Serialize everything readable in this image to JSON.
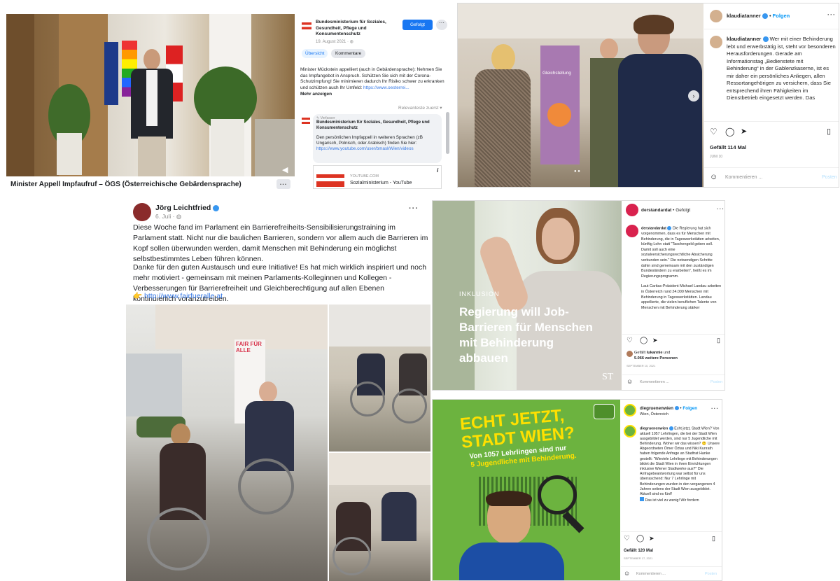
{
  "video_post": {
    "caption": "Minister Appell Impfaufruf – ÖGS (Österreichische Gebärdensprache)",
    "more": "..."
  },
  "fb_ministry": {
    "page_name": "Bundesministerium für Soziales, Gesundheit, Pflege und Konsumentenschutz",
    "date": "19. August 2021 · ",
    "follow_label": "Gefolgt",
    "tab_overview": "Übersicht",
    "tab_comments": "Kommentare",
    "body": "Minister Mückstein appelliert (auch in Gebärdensprache): Nehmen Sie das Impfangebot in Anspruch. Schützen Sie sich mit der Corona-Schutzimpfung! Sie minimieren dadurch Ihr Risiko schwer zu erkranken und schützen auch Ihr Umfeld: ",
    "body_link": "https://www.oesterrei...",
    "more": "Mehr anzeigen",
    "sort_label": "Relevanteste zuerst",
    "comment_author_tag": "Verfasser",
    "comment_author": "Bundesministerium für Soziales, Gesundheit, Pflege und Konsumentenschutz",
    "comment_text": "Den persönlichen Impfappell in weiteren Sprachen (zB Ungarisch, Polnisch, oder Arabisch) finden Sie hier: ",
    "comment_link": "https://www.youtube.com/user/bmaskWien/videos",
    "preview_domain": "YOUTUBE.COM",
    "preview_title": "Sozialministerium - YouTube"
  },
  "ig_tanner": {
    "username": "klaudiatanner",
    "follow": "Folgen",
    "sign_text": "Gleichstellung",
    "caption": "Wer mit einer Behinderung lebt und erwerbstätig ist, steht vor besonderen Herausforderungen. Gerade am Informationstag „Bedienstete mit Behinderung“ in der Gablenzkaserne, ist es mir daher ein persönliches Anliegen, allen Ressortangehörigen zu versichern, dass Sie entsprechend ihren Fähigkeiten im Dienstbetrieb eingesetzt werden. Das",
    "likes": "Gefällt 114 Mal",
    "date": "JUNI 10",
    "comment_placeholder": "Kommentieren ...",
    "post_label": "Posten"
  },
  "fb_leichtfried": {
    "author": "Jörg Leichtfried",
    "date": "6. Juli · ",
    "p1": "Diese Woche fand im Parlament ein Barrierefreiheits-Sensibilisierungstraining im Parlament statt. Nicht nur die baulichen Barrieren, sondern vor allem auch die Barrieren im Kopf sollen überwunden werden, damit Menschen mit Behinderung ein möglichst selbstbestimmtes Leben führen können.",
    "p2": "Danke für den guten Austausch und eure Initiative! Es hat mich wirklich inspiriert und noch mehr motiviert - gemeinsam mit meinen Parlaments-Kolleginnen und Kollegen - Verbesserungen für Barrierefreiheit und Gleichberechtigung auf allen Ebenen kontinuierlich voranzutreiben.",
    "link_emoji": "👉",
    "link": "http://www.fairfueralle.at",
    "banner_text": "FAIR FÜR ALLE"
  },
  "ig_standard": {
    "username": "derstandardat",
    "follow": "Gefolgt",
    "overlay_kicker": "INKLUSION",
    "overlay_headline": "Regierung will Job-Barrieren für Menschen mit Behinderung abbauen",
    "logo": "ST",
    "caption_p1": "Die Regierung hat sich vorgenommen, dass es für Menschen mit Behinderung, die in Tageswerkstätten arbeiten, künftig Lohn statt \"Taschengeld geben soll. Damit soll auch eine sozialversicherungsrechtliche Absicherung verbunden sein.\" Die notwendigen Schritte dahin sind gemeinsam mit den zuständigen Bundesländern zu erarbeiten\", heißt es im Regierungsprogramm.",
    "caption_p2": "Laut Caritas-Präsident Michael Landau arbeiten in Österreich rund 24.000 Menschen mit Behinderung in Tageswerkstätten. Landau appellierte, die vielen beruflichen Talente von Menschen mit Behinderung stärker",
    "likes_prefix": "Gefällt ",
    "likes_user": "lukannie",
    "likes_mid": " und",
    "likes_count": "5.066 weitere Personen",
    "date": "SEPTEMBER 10, 2021",
    "comment_placeholder": "Kommentieren ...",
    "post_label": "Posten"
  },
  "ig_gruene": {
    "username": "diegruenenwien",
    "follow": "Folgen",
    "location": "Wien, Österreich",
    "poster_headline_1": "ECHT JETZT,",
    "poster_headline_2": "STADT WIEN?",
    "poster_sub_1": "Von 1057 Lehrlingen sind nur",
    "poster_sub_2": "5 Jugendliche mit Behinderung.",
    "caption": "Echt jetzt, Stadt Wien? Von aktuell 1057 Lehrlingen, die bei der Stadt Wien ausgebildet werden, sind nur 5 Jugendliche mit Behinderung. Woher wir das wissen? 🙂 Unsere Abgeordneten Ömer Öztas und Niki Kunrath haben folgende Anfrage an Stadtrat Hanke gestellt: \"Wieviele Lehrlinge mit Behinderungen bildet die Stadt Wien in ihren Einrichtungen inklusive Wiener Stadtwerke aus?\" Die Anfragebeantwortung war selbst für uns überraschend: Nur 7 Lehrlinge mit Behinderungen wurden in den vergangenen 4 Jahren seitens der Stadt Wien ausgebildet. Aktuell sind es fünf!",
    "caption_tail": "Das ist viel zu wenig! Wir fordern",
    "likes": "Gefällt 120 Mal",
    "date": "SEPTEMBER 17, 2021",
    "comment_placeholder": "Kommentieren ...",
    "post_label": "Posten"
  },
  "colors": {
    "ig_blue": "#0095f6",
    "fb_blue": "#1877f2",
    "gruene_green": "#6cb33f",
    "gruene_yellow": "#ffe000",
    "standard_red": "#d9224e"
  }
}
